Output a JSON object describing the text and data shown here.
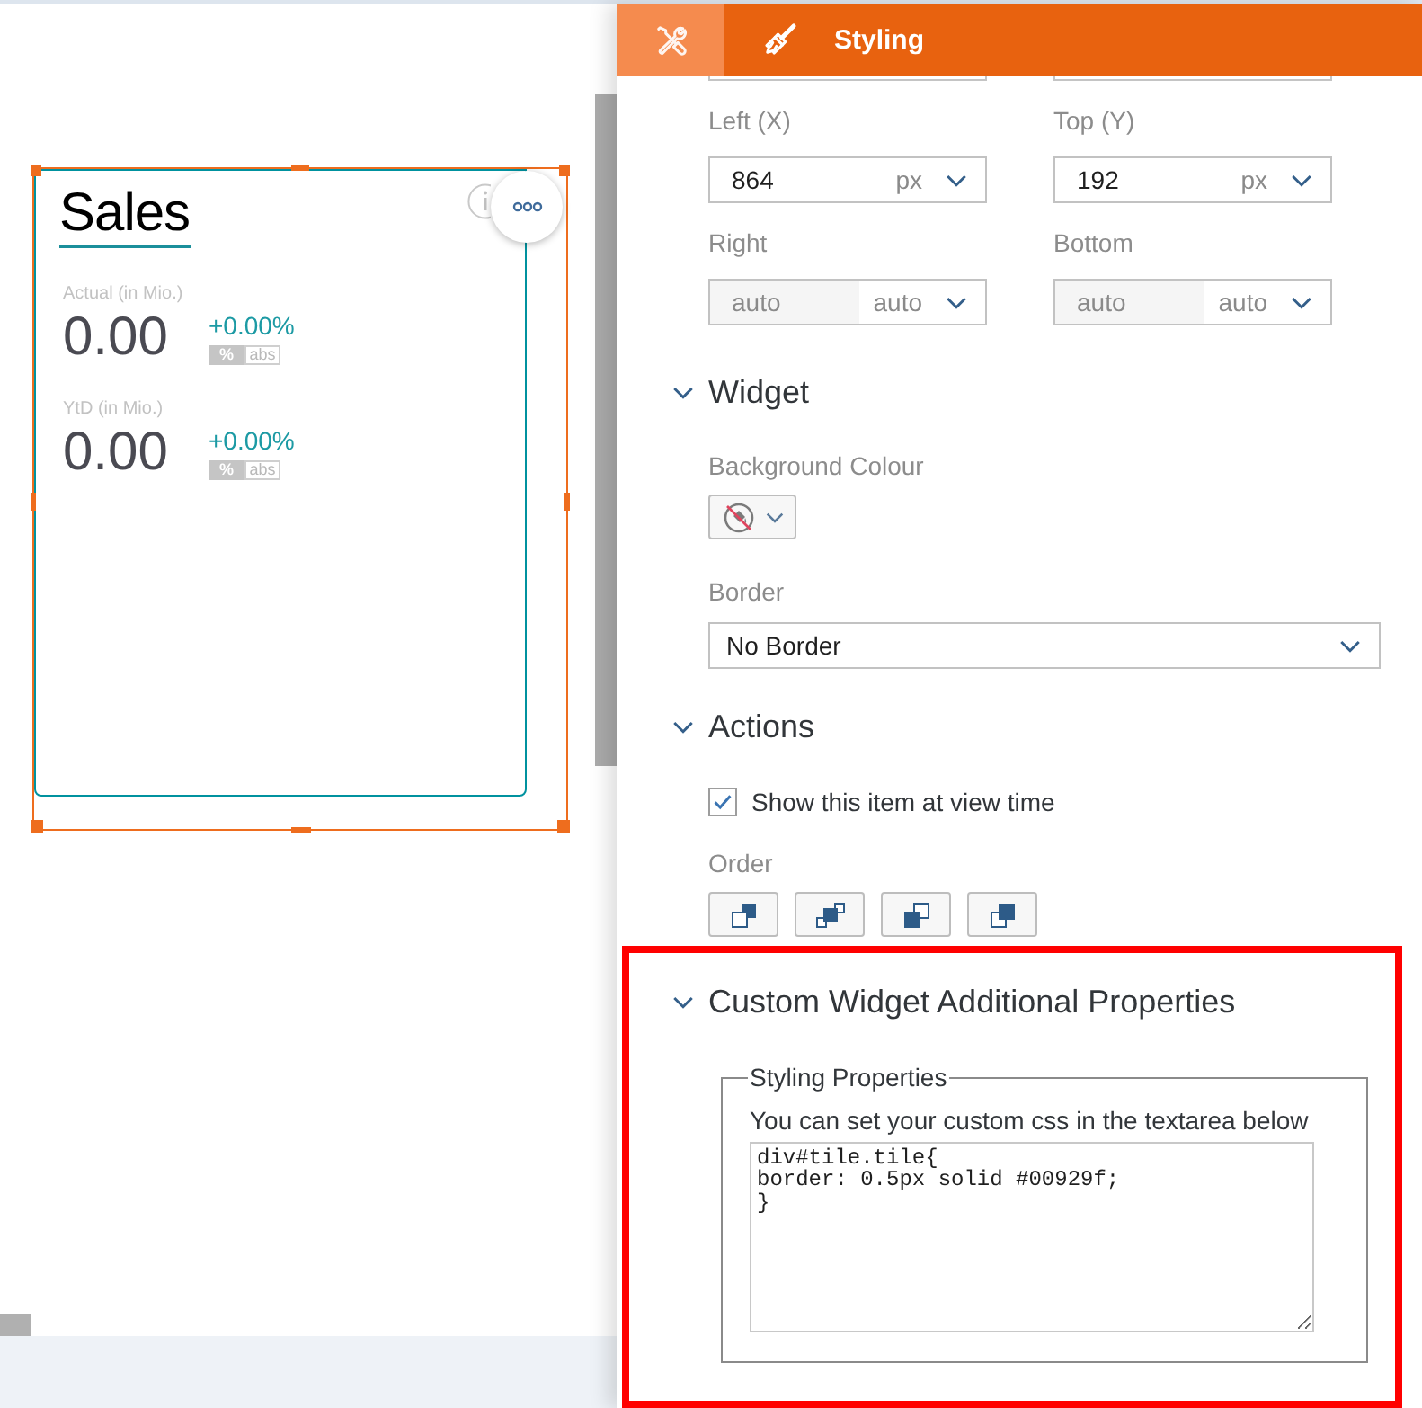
{
  "canvas": {
    "widget": {
      "selected": true,
      "title": "Sales",
      "kpis": [
        {
          "label": "Actual (in Mio.)",
          "value": "0.00",
          "delta": "+0.00%",
          "modes": [
            {
              "label": "%",
              "selected": true
            },
            {
              "label": "abs",
              "selected": false
            }
          ]
        },
        {
          "label": "YtD (in Mio.)",
          "value": "0.00",
          "delta": "+0.00%",
          "modes": [
            {
              "label": "%",
              "selected": true
            },
            {
              "label": "abs",
              "selected": false
            }
          ]
        }
      ]
    }
  },
  "panel": {
    "tabs": [
      {
        "kind": "builder",
        "selected": false,
        "hovered": true
      },
      {
        "kind": "styling",
        "label": "Styling",
        "selected": true,
        "hovered": false
      }
    ],
    "scrolled_fields": [
      {
        "kind": "field"
      },
      {
        "kind": "field"
      }
    ],
    "position": [
      {
        "label": "Left (X)",
        "value": "864",
        "unit": "px",
        "disabled": false
      },
      {
        "label": "Top (Y)",
        "value": "192",
        "unit": "px",
        "disabled": false
      },
      {
        "label": "Right",
        "value": "auto",
        "unit": "auto",
        "disabled": true
      },
      {
        "label": "Bottom",
        "value": "auto",
        "unit": "auto",
        "disabled": true
      }
    ],
    "widget_section": {
      "title": "Widget",
      "expanded": true,
      "background_colour": {
        "label": "Background Colour"
      },
      "border": {
        "label": "Border",
        "value": "No Border"
      }
    },
    "actions_section": {
      "title": "Actions",
      "expanded": true,
      "show_at_view_time": {
        "label": "Show this item at view time",
        "checked": true
      },
      "order": {
        "label": "Order",
        "buttons": [
          {
            "kind": "front"
          },
          {
            "kind": "forward"
          },
          {
            "kind": "backward"
          },
          {
            "kind": "back"
          }
        ]
      }
    },
    "custom_section": {
      "title": "Custom Widget Additional Properties",
      "expanded": true,
      "highlighted": true,
      "group": {
        "legend": "Styling Properties",
        "hint": "You can set your custom css in the textarea below",
        "css": "div#tile.tile{\nborder: 0.5px solid #00929f;\n}"
      }
    }
  }
}
